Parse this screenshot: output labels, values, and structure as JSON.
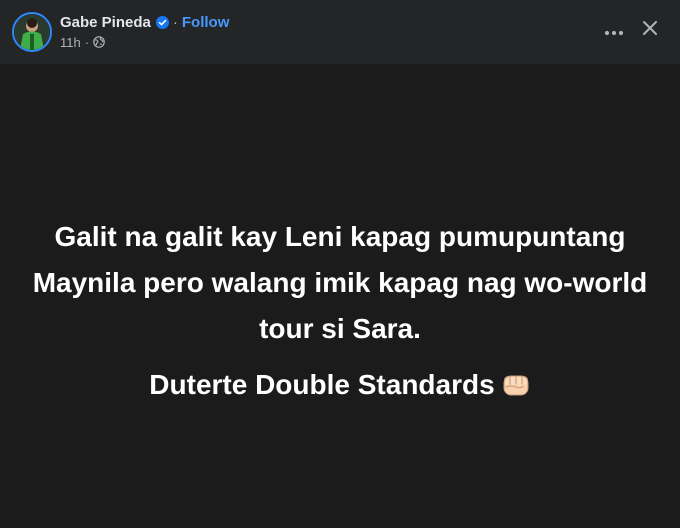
{
  "header": {
    "author_name": "Gabe Pineda",
    "separator": "·",
    "follow_label": "Follow",
    "time": "11h",
    "meta_separator": "·",
    "privacy_icon": "globe-icon",
    "verified_icon": "verified-badge-icon",
    "more_icon": "more-dots-icon",
    "close_icon": "close-icon"
  },
  "post": {
    "line1": "Galit na galit kay Leni kapag pumupuntang Maynila pero walang imik kapag nag wo-world tour si Sara.",
    "line2": "Duterte Double Standards",
    "emoji_icon": "oncoming-fist-icon"
  },
  "colors": {
    "header_bg": "#242526",
    "body_bg": "#1b1b1b",
    "accent": "#4599ff",
    "text_primary": "#e4e6eb",
    "text_secondary": "#b0b3b8"
  }
}
